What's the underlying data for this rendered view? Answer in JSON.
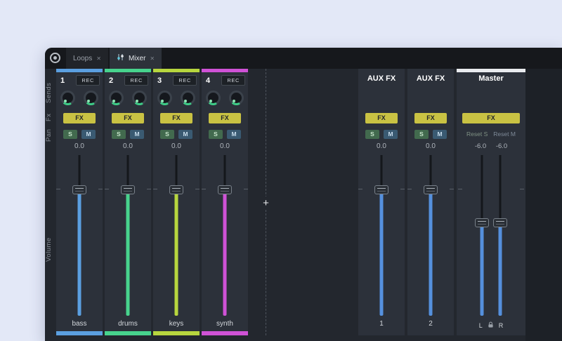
{
  "colors": {
    "page_bg": "#e3e8f7",
    "window_bg": "#23272e",
    "tabbar_bg": "#16181c",
    "channel_bg": "#2c313a",
    "fx_button": "#c9c243",
    "solo_bg": "#426a4e",
    "mute_bg": "#3a5a72",
    "accent_blue": "#5590dd",
    "master_strip": "#e9ebee",
    "knob_indicator": "#3ecb87"
  },
  "tabbar": {
    "tabs": [
      {
        "label": "Loops",
        "close": "✕"
      },
      {
        "label": "Mixer",
        "close": "✕",
        "icon": "mixer-sliders-icon"
      }
    ]
  },
  "rail": {
    "labels": [
      "Sends",
      "Fx",
      "Pan",
      "Volume"
    ]
  },
  "channels": [
    {
      "number": "1",
      "rec": "REC",
      "fx": "FX",
      "solo": "S",
      "mute": "M",
      "value": "0.0",
      "name": "bass",
      "color": "#5b9fe0"
    },
    {
      "number": "2",
      "rec": "REC",
      "fx": "FX",
      "solo": "S",
      "mute": "M",
      "value": "0.0",
      "name": "drums",
      "color": "#47d38d"
    },
    {
      "number": "3",
      "rec": "REC",
      "fx": "FX",
      "solo": "S",
      "mute": "M",
      "value": "0.0",
      "name": "keys",
      "color": "#b7d63e"
    },
    {
      "number": "4",
      "rec": "REC",
      "fx": "FX",
      "solo": "S",
      "mute": "M",
      "value": "0.0",
      "name": "synth",
      "color": "#cf52d6"
    }
  ],
  "aux_channels": [
    {
      "title": "AUX FX",
      "fx": "FX",
      "solo": "S",
      "mute": "M",
      "value": "0.0",
      "name": "1"
    },
    {
      "title": "AUX FX",
      "fx": "FX",
      "solo": "S",
      "mute": "M",
      "value": "0.0",
      "name": "2"
    }
  ],
  "master": {
    "title": "Master",
    "fx": "FX",
    "reset_solo": "Reset S",
    "reset_mute": "Reset M",
    "value_left": "-6.0",
    "value_right": "-6.0",
    "label_left": "L",
    "label_right": "R"
  },
  "add_channel": "+"
}
